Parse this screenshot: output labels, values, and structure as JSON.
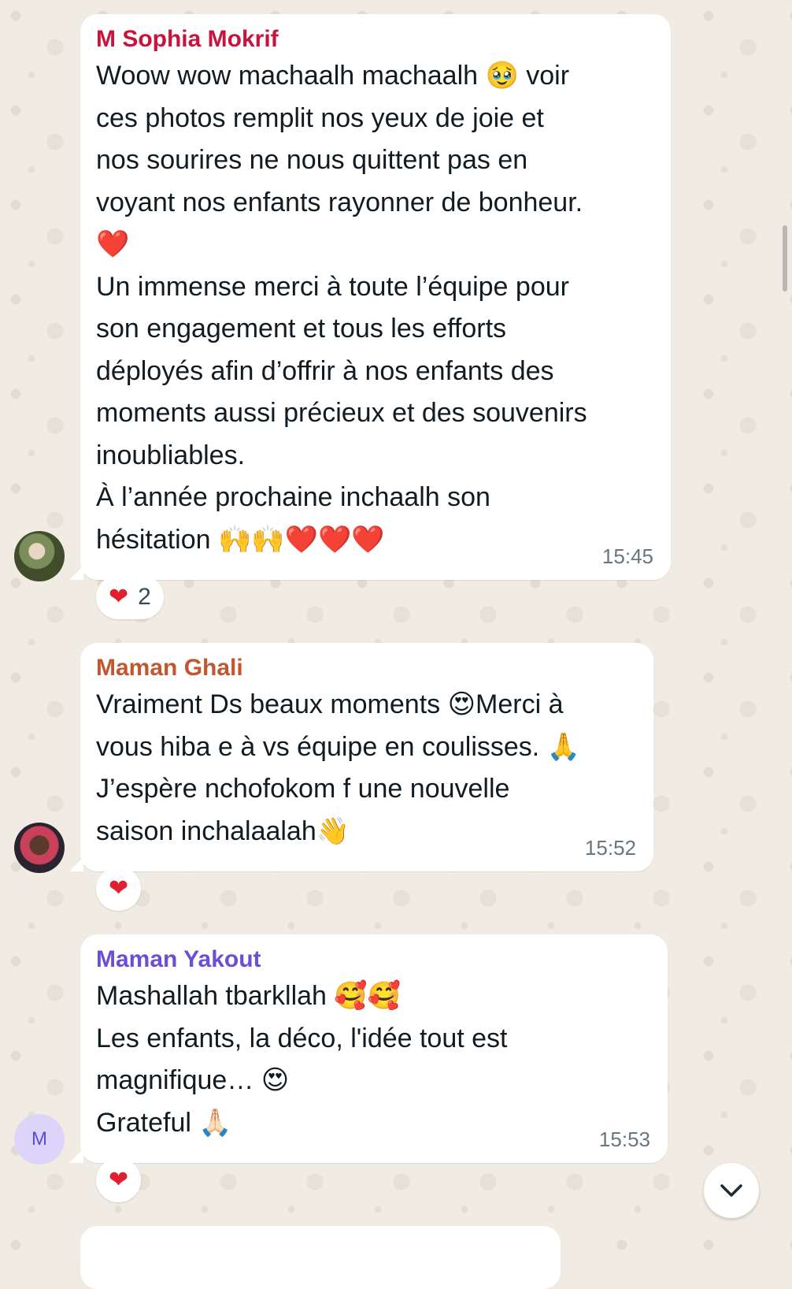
{
  "messages": [
    {
      "sender": "M Sophia Mokrif",
      "sender_color": "#c8143c",
      "text": "Woow wow machaalh machaalh 🥹 voir\nces photos remplit nos yeux de joie et\nnos sourires ne nous quittent pas en\nvoyant nos enfants rayonner de bonheur.\n❤️\nUn immense merci à toute l’équipe pour\nson engagement et tous les efforts\ndéployés afin d’offrir à nos enfants des\nmoments aussi précieux et des souvenirs\ninoubliables.\nÀ l’année prochaine inchaalh son\nhésitation 🙌🙌❤️❤️❤️",
      "time": "15:45",
      "reaction_emoji": "❤",
      "reaction_count": "2"
    },
    {
      "sender": "Maman Ghali",
      "sender_color": "#c2572f",
      "text": "Vraiment Ds beaux moments 😍Merci à\nvous hiba e à vs équipe en coulisses. 🙏\nJ’espère nchofokom f une nouvelle\nsaison inchalaalah👋",
      "time": "15:52",
      "reaction_emoji": "❤"
    },
    {
      "sender": "Maman Yakout",
      "sender_color": "#6a4fd6",
      "avatar_initial": "M",
      "text": "Mashallah tbarkllah 🥰🥰\nLes enfants, la déco, l'idée tout est\nmagnifique… 😍\nGrateful 🙏🏻",
      "time": "15:53",
      "reaction_emoji": "❤"
    }
  ],
  "icons": {
    "scroll_down": "chevron-down-icon"
  }
}
